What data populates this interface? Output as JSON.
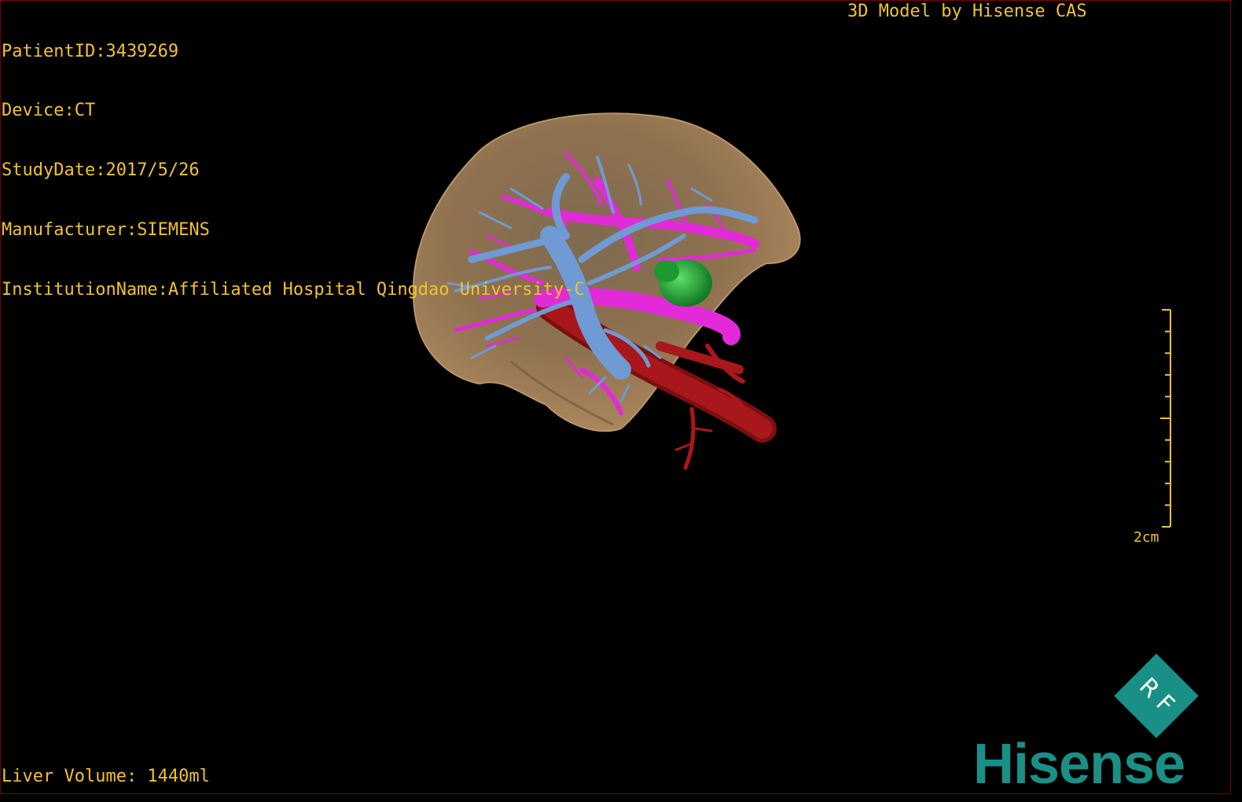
{
  "overlay": {
    "patient_id": "PatientID:3439269",
    "device": "Device:CT",
    "study_date": "StudyDate:2017/5/26",
    "manufacturer": "Manufacturer:SIEMENS",
    "institution": "InstitutionName:Affiliated Hospital Qingdao University-C",
    "model_credit": "3D Model by Hisense CAS",
    "liver_volume": "Liver Volume: 1440ml"
  },
  "scale_bar": {
    "label": "2cm"
  },
  "logo": {
    "badge_text": "R F",
    "brand": "Hisense"
  },
  "colors": {
    "overlay_text": "#f2c230",
    "liver": "#9c7a52",
    "portal_vein": "#e22ad8",
    "hepatic_vein": "#6f9ad3",
    "artery": "#b0151a",
    "lesion": "#1fa83a",
    "brand": "#1a8f86"
  }
}
